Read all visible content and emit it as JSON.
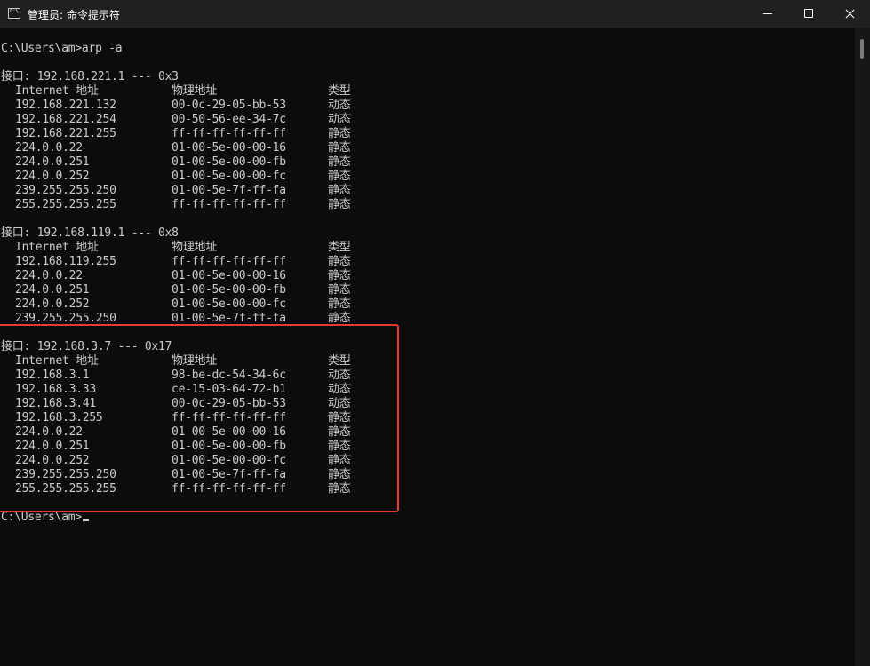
{
  "window": {
    "title": "管理员: 命令提示符",
    "icon": "cmd-icon"
  },
  "console": {
    "prompt_cmd": "C:\\Users\\am>arp -a",
    "interfaces": [
      {
        "header": "接口: 192.168.221.1 --- 0x3",
        "columns": [
          "Internet 地址",
          "物理地址",
          "类型"
        ],
        "rows": [
          [
            "192.168.221.132",
            "00-0c-29-05-bb-53",
            "动态"
          ],
          [
            "192.168.221.254",
            "00-50-56-ee-34-7c",
            "动态"
          ],
          [
            "192.168.221.255",
            "ff-ff-ff-ff-ff-ff",
            "静态"
          ],
          [
            "224.0.0.22",
            "01-00-5e-00-00-16",
            "静态"
          ],
          [
            "224.0.0.251",
            "01-00-5e-00-00-fb",
            "静态"
          ],
          [
            "224.0.0.252",
            "01-00-5e-00-00-fc",
            "静态"
          ],
          [
            "239.255.255.250",
            "01-00-5e-7f-ff-fa",
            "静态"
          ],
          [
            "255.255.255.255",
            "ff-ff-ff-ff-ff-ff",
            "静态"
          ]
        ]
      },
      {
        "header": "接口: 192.168.119.1 --- 0x8",
        "columns": [
          "Internet 地址",
          "物理地址",
          "类型"
        ],
        "rows": [
          [
            "192.168.119.255",
            "ff-ff-ff-ff-ff-ff",
            "静态"
          ],
          [
            "224.0.0.22",
            "01-00-5e-00-00-16",
            "静态"
          ],
          [
            "224.0.0.251",
            "01-00-5e-00-00-fb",
            "静态"
          ],
          [
            "224.0.0.252",
            "01-00-5e-00-00-fc",
            "静态"
          ],
          [
            "239.255.255.250",
            "01-00-5e-7f-ff-fa",
            "静态"
          ]
        ]
      },
      {
        "header": "接口: 192.168.3.7 --- 0x17",
        "columns": [
          "Internet 地址",
          "物理地址",
          "类型"
        ],
        "rows": [
          [
            "192.168.3.1",
            "98-be-dc-54-34-6c",
            "动态"
          ],
          [
            "192.168.3.33",
            "ce-15-03-64-72-b1",
            "动态"
          ],
          [
            "192.168.3.41",
            "00-0c-29-05-bb-53",
            "动态"
          ],
          [
            "192.168.3.255",
            "ff-ff-ff-ff-ff-ff",
            "静态"
          ],
          [
            "224.0.0.22",
            "01-00-5e-00-00-16",
            "静态"
          ],
          [
            "224.0.0.251",
            "01-00-5e-00-00-fb",
            "静态"
          ],
          [
            "224.0.0.252",
            "01-00-5e-00-00-fc",
            "静态"
          ],
          [
            "239.255.255.250",
            "01-00-5e-7f-ff-fa",
            "静态"
          ],
          [
            "255.255.255.255",
            "ff-ff-ff-ff-ff-ff",
            "静态"
          ]
        ]
      }
    ],
    "final_prompt": "C:\\Users\\am>"
  },
  "annotation": {
    "color": "#e53935"
  }
}
